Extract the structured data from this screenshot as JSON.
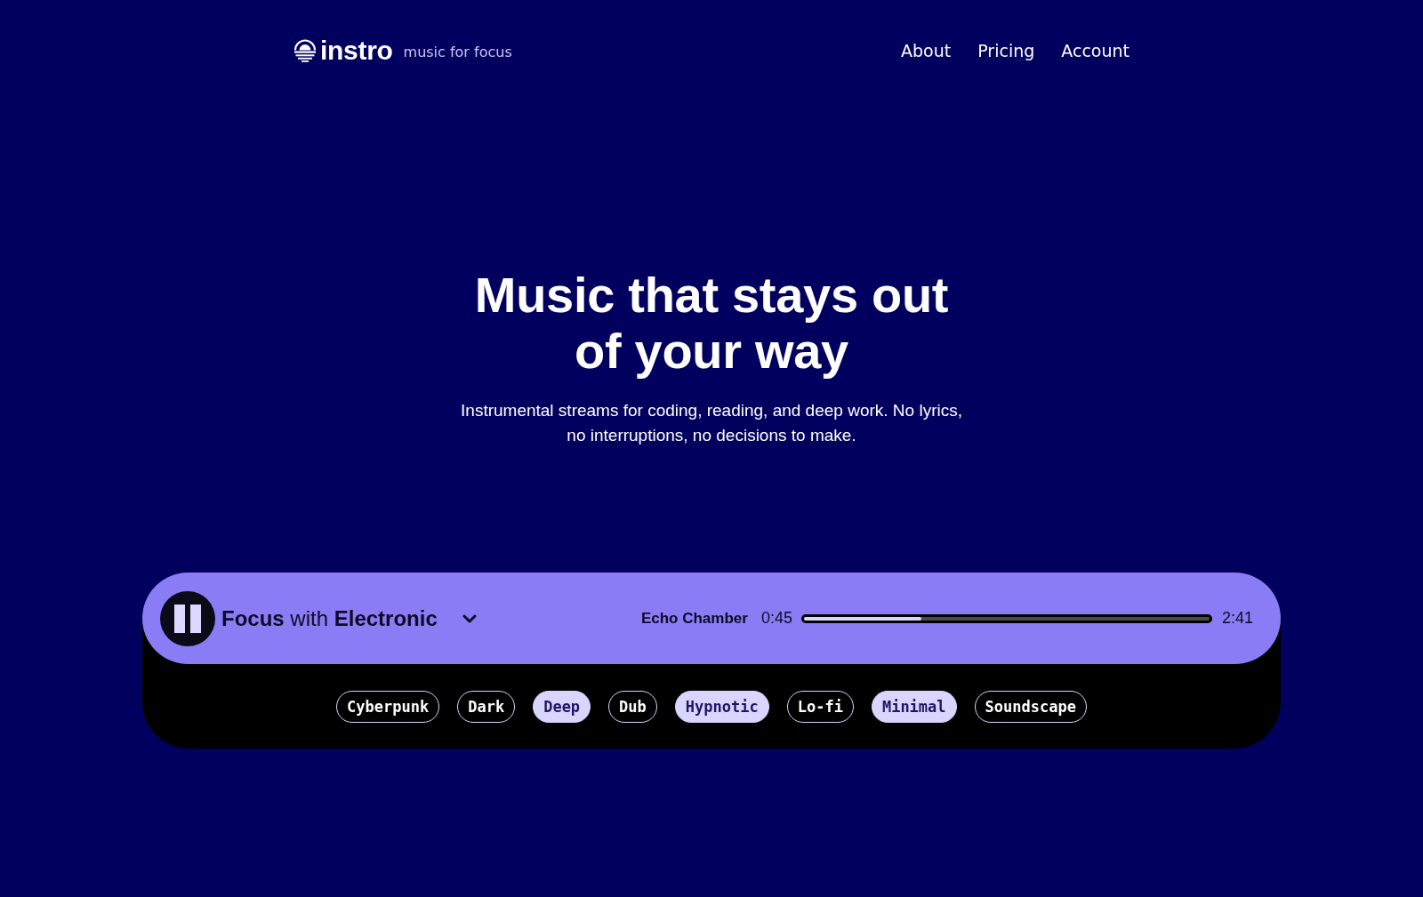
{
  "header": {
    "logo": {
      "wordmark": "instro",
      "tagline": "music for focus"
    },
    "nav": [
      {
        "label": "About"
      },
      {
        "label": "Pricing"
      },
      {
        "label": "Account"
      }
    ]
  },
  "hero": {
    "title": "Music that stays out of your way",
    "subtitle": "Instrumental streams for coding, reading, and deep work. No lyrics, no interruptions, no decisions to make."
  },
  "player": {
    "playing": true,
    "station": "**Focus** with **Electronic**",
    "track": "Echo Chamber",
    "elapsed": "0:45",
    "duration": "2:41",
    "progress": {
      "level": 0.29
    },
    "tags": [
      {
        "label": "Cyberpunk",
        "selected": false
      },
      {
        "label": "Dark",
        "selected": false
      },
      {
        "label": "Deep",
        "selected": true
      },
      {
        "label": "Dub",
        "selected": false
      },
      {
        "label": "Hypnotic",
        "selected": true
      },
      {
        "label": "Lo-fi",
        "selected": false
      },
      {
        "label": "Minimal",
        "selected": true
      },
      {
        "label": "Soundscape",
        "selected": false
      }
    ]
  }
}
